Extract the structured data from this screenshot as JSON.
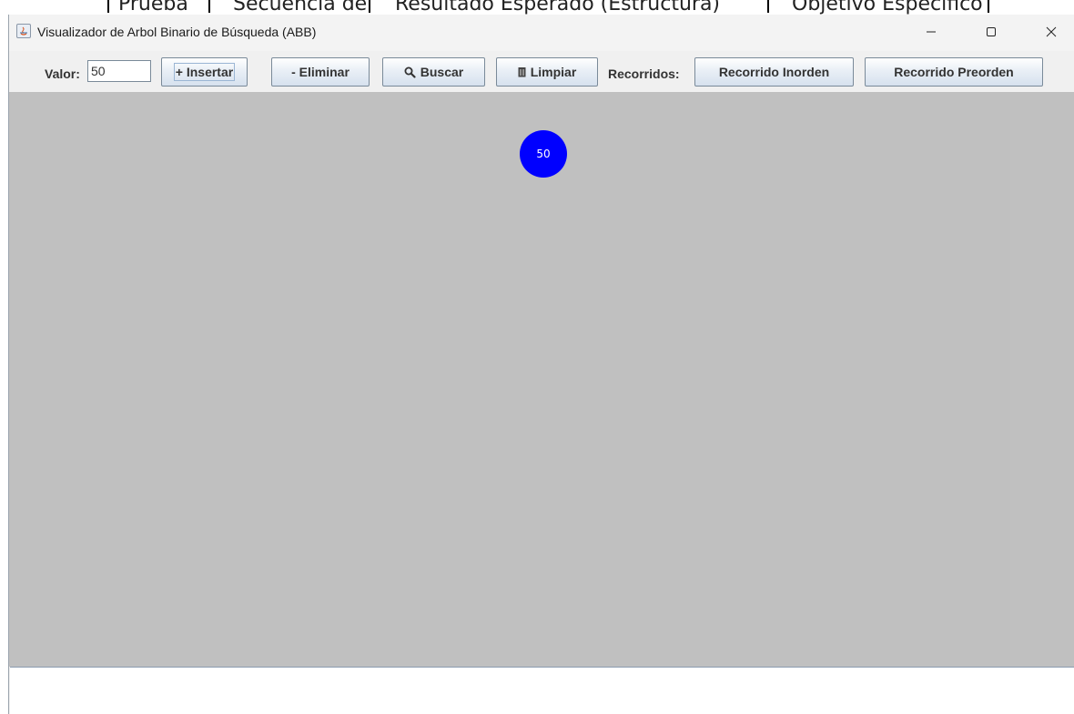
{
  "background_window": {
    "fragments": [
      "Prueba",
      "Secuencia de",
      "Resultado Esperado (Estructura)",
      "Objetivo Específico"
    ]
  },
  "window": {
    "title": "Visualizador de Arbol Binario de Búsqueda (ABB)",
    "controls": {
      "minimize": "minimize-icon",
      "maximize": "maximize-icon",
      "close": "close-icon"
    }
  },
  "toolbar": {
    "valor_label": "Valor:",
    "valor_value": "50",
    "insert_label": "+ Insertar",
    "delete_label": "- Eliminar",
    "search_label": "Buscar",
    "search_icon": "magnifier-icon",
    "clear_label": "Limpiar",
    "clear_icon": "trash-icon",
    "traversals_label": "Recorridos:",
    "inorder_label": "Recorrido Inorden",
    "preorder_label": "Recorrido Preorden"
  },
  "canvas": {
    "background": "#c0c0c0",
    "node_color": "#0000ff",
    "node_text_color": "#ffffff",
    "tree": [
      {
        "value": "50",
        "level": 0
      }
    ]
  },
  "output": {
    "text": ""
  }
}
